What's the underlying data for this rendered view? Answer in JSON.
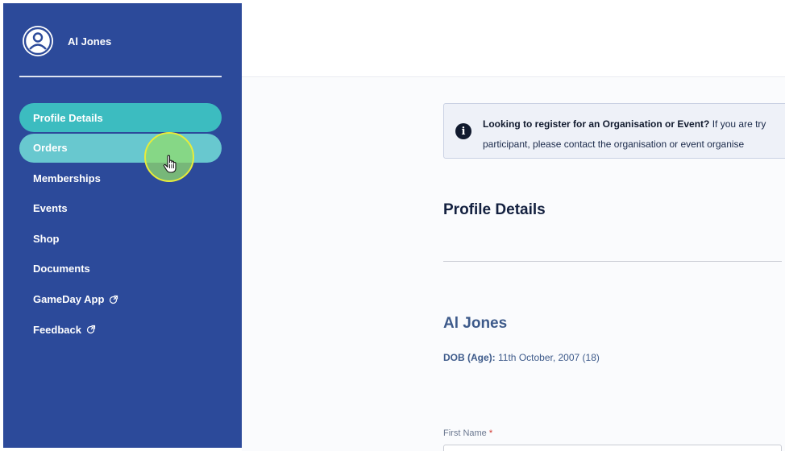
{
  "user": {
    "name": "Al Jones",
    "avatar_icon": "user-circle-icon"
  },
  "nav": {
    "items": [
      {
        "label": "Profile Details",
        "state": "active"
      },
      {
        "label": "Orders",
        "state": "hover"
      },
      {
        "label": "Memberships"
      },
      {
        "label": "Events"
      },
      {
        "label": "Shop"
      },
      {
        "label": "Documents"
      },
      {
        "label": "GameDay App",
        "icon": "external-link-icon"
      },
      {
        "label": "Feedback",
        "icon": "external-link-icon"
      }
    ]
  },
  "alert": {
    "icon": "info-icon",
    "title": "Looking to register for an Organisation or Event?",
    "body_line1": "If you are try",
    "body_line2": "participant, please contact the organisation or event organise"
  },
  "profile": {
    "section_title": "Profile Details",
    "name": "Al Jones",
    "dob_label": "DOB (Age):",
    "dob_value": "11th October, 2007 (18)",
    "first_name_label": "First Name",
    "required_mark": "*"
  },
  "colors": {
    "sidebar": "#2c4a9a",
    "active_item": "#3cbcc0",
    "hover_item": "#68c8cf",
    "cursor_highlight": "#90dc6e",
    "cursor_ring": "#e8ec3a"
  }
}
